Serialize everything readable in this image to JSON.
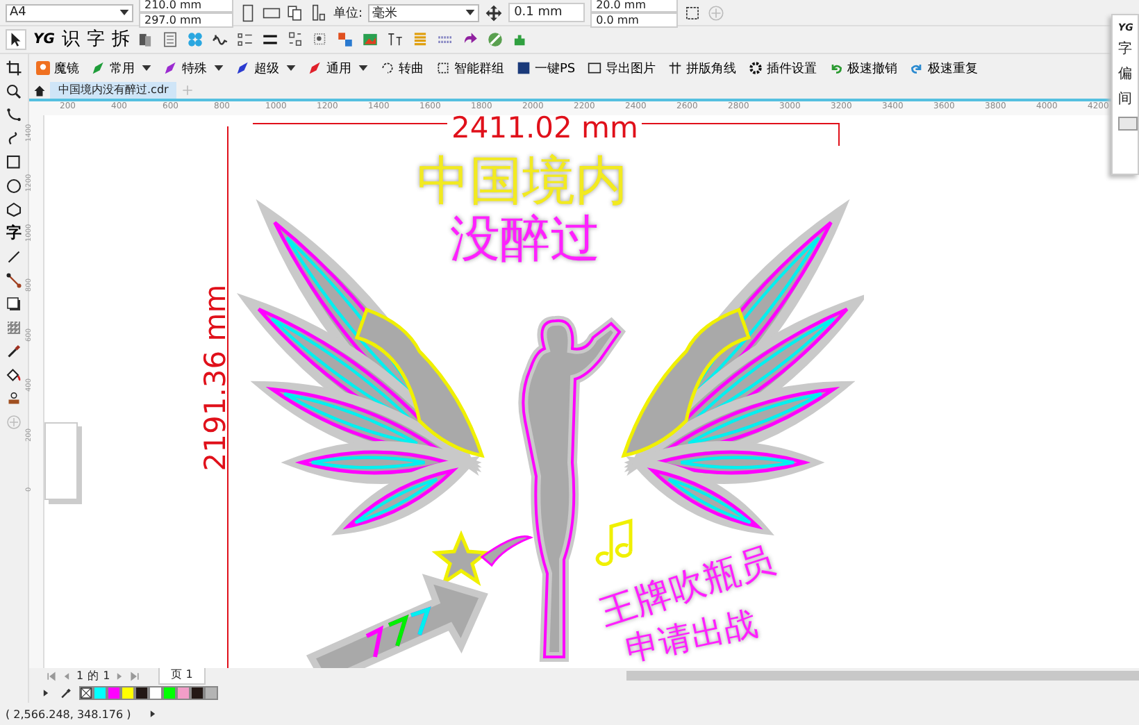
{
  "property_bar": {
    "page_size": "A4",
    "width": "210.0 mm",
    "height": "297.0 mm",
    "unit_label": "单位:",
    "unit": "毫米",
    "nudge": "0.1 mm",
    "dup_x": "20.0 mm",
    "dup_y": "0.0 mm"
  },
  "toolbar": {
    "logo": "YG",
    "glyph_buttons": [
      "识",
      "字",
      "拆"
    ]
  },
  "plugin_bar": [
    {
      "label": "魔镜",
      "kind": "brand"
    },
    {
      "label": "常用",
      "kind": "dropdown",
      "color": "#1f9d3a"
    },
    {
      "label": "特殊",
      "kind": "dropdown",
      "color": "#9b2bd0"
    },
    {
      "label": "超级",
      "kind": "dropdown",
      "color": "#2b3bd0"
    },
    {
      "label": "通用",
      "kind": "dropdown",
      "color": "#e0202a"
    },
    {
      "label": "转曲",
      "kind": "action"
    },
    {
      "label": "智能群组",
      "kind": "action"
    },
    {
      "label": "一键PS",
      "kind": "action"
    },
    {
      "label": "导出图片",
      "kind": "action"
    },
    {
      "label": "拼版角线",
      "kind": "action"
    },
    {
      "label": "插件设置",
      "kind": "action"
    },
    {
      "label": "极速撤销",
      "kind": "action"
    },
    {
      "label": "极速重复",
      "kind": "action"
    }
  ],
  "document_tab": {
    "title": "中国境内没有醉过.cdr",
    "selected": true
  },
  "toolbox": {
    "text_tool": "字"
  },
  "ruler": {
    "x_labels": [
      "200",
      "400",
      "600",
      "800",
      "1000",
      "1200",
      "1400",
      "1600",
      "1800",
      "2000",
      "2200",
      "2400",
      "2600",
      "2800",
      "3000",
      "3200",
      "3400",
      "3600",
      "3800",
      "4000",
      "4200"
    ],
    "y_labels": [
      "1400",
      "1200",
      "1000",
      "800",
      "600",
      "400",
      "200",
      "0"
    ]
  },
  "artwork": {
    "dimension_width": "2411.02 mm",
    "dimension_height": "2191.36 mm",
    "title_lines": [
      "中国境内",
      "没醉过"
    ],
    "slogan_lines": [
      "王牌吹瓶员",
      "申请出战"
    ]
  },
  "page_nav": {
    "current": "1",
    "of": "的",
    "total": "1",
    "page_tab": "页 1"
  },
  "palette": [
    {
      "kind": "none"
    },
    {
      "kind": "swatch",
      "color": "#00ffff"
    },
    {
      "kind": "swatch",
      "color": "#ff00ff"
    },
    {
      "kind": "swatch",
      "color": "#ffff00"
    },
    {
      "kind": "swatch",
      "color": "#231815"
    },
    {
      "kind": "swatch",
      "color": "#ffffff"
    },
    {
      "kind": "swatch",
      "color": "#00ff00"
    },
    {
      "kind": "swatch",
      "color": "#f29ec8"
    },
    {
      "kind": "swatch",
      "color": "#231815"
    },
    {
      "kind": "swatch",
      "color": "#b4b4b4"
    }
  ],
  "docker": {
    "logo": "YG",
    "labels": [
      "字",
      "偏",
      "间"
    ]
  },
  "status_bar": {
    "coordinates": "( 2,566.248, 348.176 )"
  }
}
